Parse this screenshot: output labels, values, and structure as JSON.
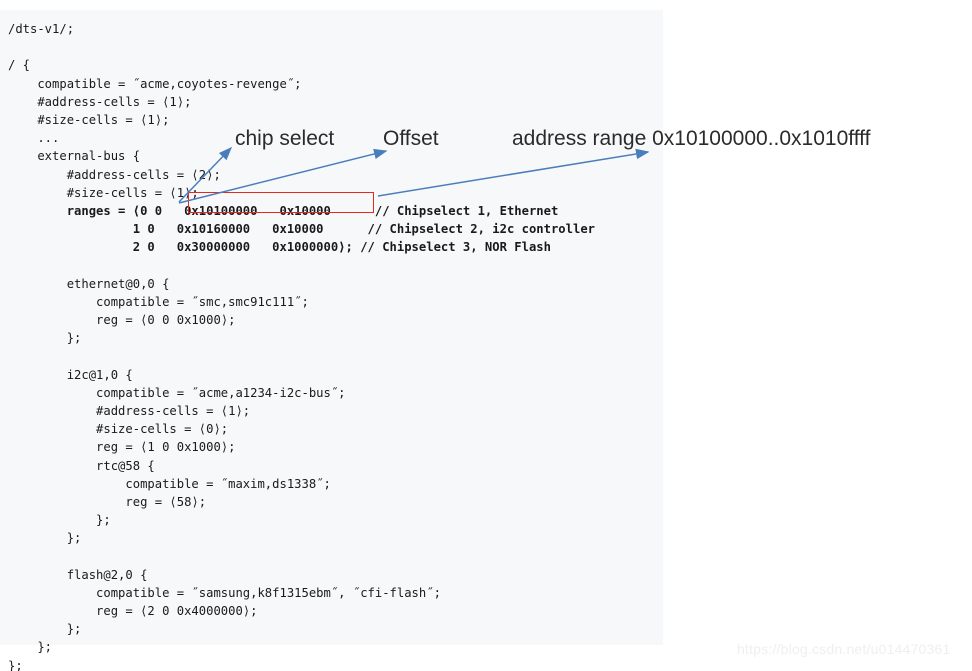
{
  "code": {
    "language": "device-tree-source",
    "lines": [
      {
        "text": "/dts-v1/;",
        "bold": false
      },
      {
        "text": "",
        "bold": false
      },
      {
        "text": "/ {",
        "bold": false
      },
      {
        "text": "    compatible = ˝acme,coyotes-revenge˝;",
        "bold": false
      },
      {
        "text": "    #address-cells = ⟨1⟩;",
        "bold": false
      },
      {
        "text": "    #size-cells = ⟨1⟩;",
        "bold": false
      },
      {
        "text": "    ...",
        "bold": false
      },
      {
        "text": "    external-bus {",
        "bold": false
      },
      {
        "text": "        #address-cells = ⟨2⟩;",
        "bold": false
      },
      {
        "text": "        #size-cells = ⟨1⟩;",
        "bold": false
      },
      {
        "text": "        ranges = ⟨0 0   0x10100000   0x10000      // Chipselect 1, Ethernet",
        "bold": true
      },
      {
        "text": "                 1 0   0x10160000   0x10000      // Chipselect 2, i2c controller",
        "bold": true
      },
      {
        "text": "                 2 0   0x30000000   0x1000000⟩; // Chipselect 3, NOR Flash",
        "bold": true
      },
      {
        "text": "",
        "bold": false
      },
      {
        "text": "        ethernet@0,0 {",
        "bold": false
      },
      {
        "text": "            compatible = ˝smc,smc91c111˝;",
        "bold": false
      },
      {
        "text": "            reg = ⟨0 0 0x1000⟩;",
        "bold": false
      },
      {
        "text": "        };",
        "bold": false
      },
      {
        "text": "",
        "bold": false
      },
      {
        "text": "        i2c@1,0 {",
        "bold": false
      },
      {
        "text": "            compatible = ˝acme,a1234-i2c-bus˝;",
        "bold": false
      },
      {
        "text": "            #address-cells = ⟨1⟩;",
        "bold": false
      },
      {
        "text": "            #size-cells = ⟨0⟩;",
        "bold": false
      },
      {
        "text": "            reg = ⟨1 0 0x1000⟩;",
        "bold": false
      },
      {
        "text": "            rtc@58 {",
        "bold": false
      },
      {
        "text": "                compatible = ˝maxim,ds1338˝;",
        "bold": false
      },
      {
        "text": "                reg = ⟨58⟩;",
        "bold": false
      },
      {
        "text": "            };",
        "bold": false
      },
      {
        "text": "        };",
        "bold": false
      },
      {
        "text": "",
        "bold": false
      },
      {
        "text": "        flash@2,0 {",
        "bold": false
      },
      {
        "text": "            compatible = ˝samsung,k8f1315ebm˝, ˝cfi-flash˝;",
        "bold": false
      },
      {
        "text": "            reg = ⟨2 0 0x4000000⟩;",
        "bold": false
      },
      {
        "text": "        };",
        "bold": false
      },
      {
        "text": "    };",
        "bold": false
      },
      {
        "text": "};",
        "bold": false
      }
    ]
  },
  "highlight": {
    "color": "#e8281e",
    "target_text": "0x10100000   0x10000"
  },
  "annotations": [
    {
      "id": "chip-select",
      "label": "chip select"
    },
    {
      "id": "offset",
      "label": "Offset"
    },
    {
      "id": "address-range",
      "label": "address range 0x10100000..0x1010ffff"
    }
  ],
  "arrows": {
    "color": "#4a7ebb",
    "count": 3
  },
  "watermark": {
    "text": "https://blog.csdn.net/u014470361"
  },
  "colors": {
    "code_background": "#f7f8fa",
    "page_background": "#ffffff",
    "code_text": "#1a1a1a",
    "annotation_text": "#2b2b2b",
    "arrow": "#4a7ebb",
    "highlight_border": "#e8281e",
    "watermark": "#efefef"
  }
}
